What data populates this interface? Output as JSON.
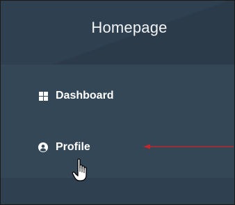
{
  "sidebar": {
    "title": "Homepage",
    "items": [
      {
        "label": "Dashboard",
        "icon": "grid-icon"
      },
      {
        "label": "Profile",
        "icon": "user-circle-icon"
      }
    ]
  },
  "colors": {
    "sidebar_bg": "#344757",
    "header_bg": "#2f4050",
    "text": "#ffffff",
    "annotation_arrow": "#c0272d"
  },
  "annotation": {
    "type": "arrow",
    "points_to": "Profile"
  }
}
